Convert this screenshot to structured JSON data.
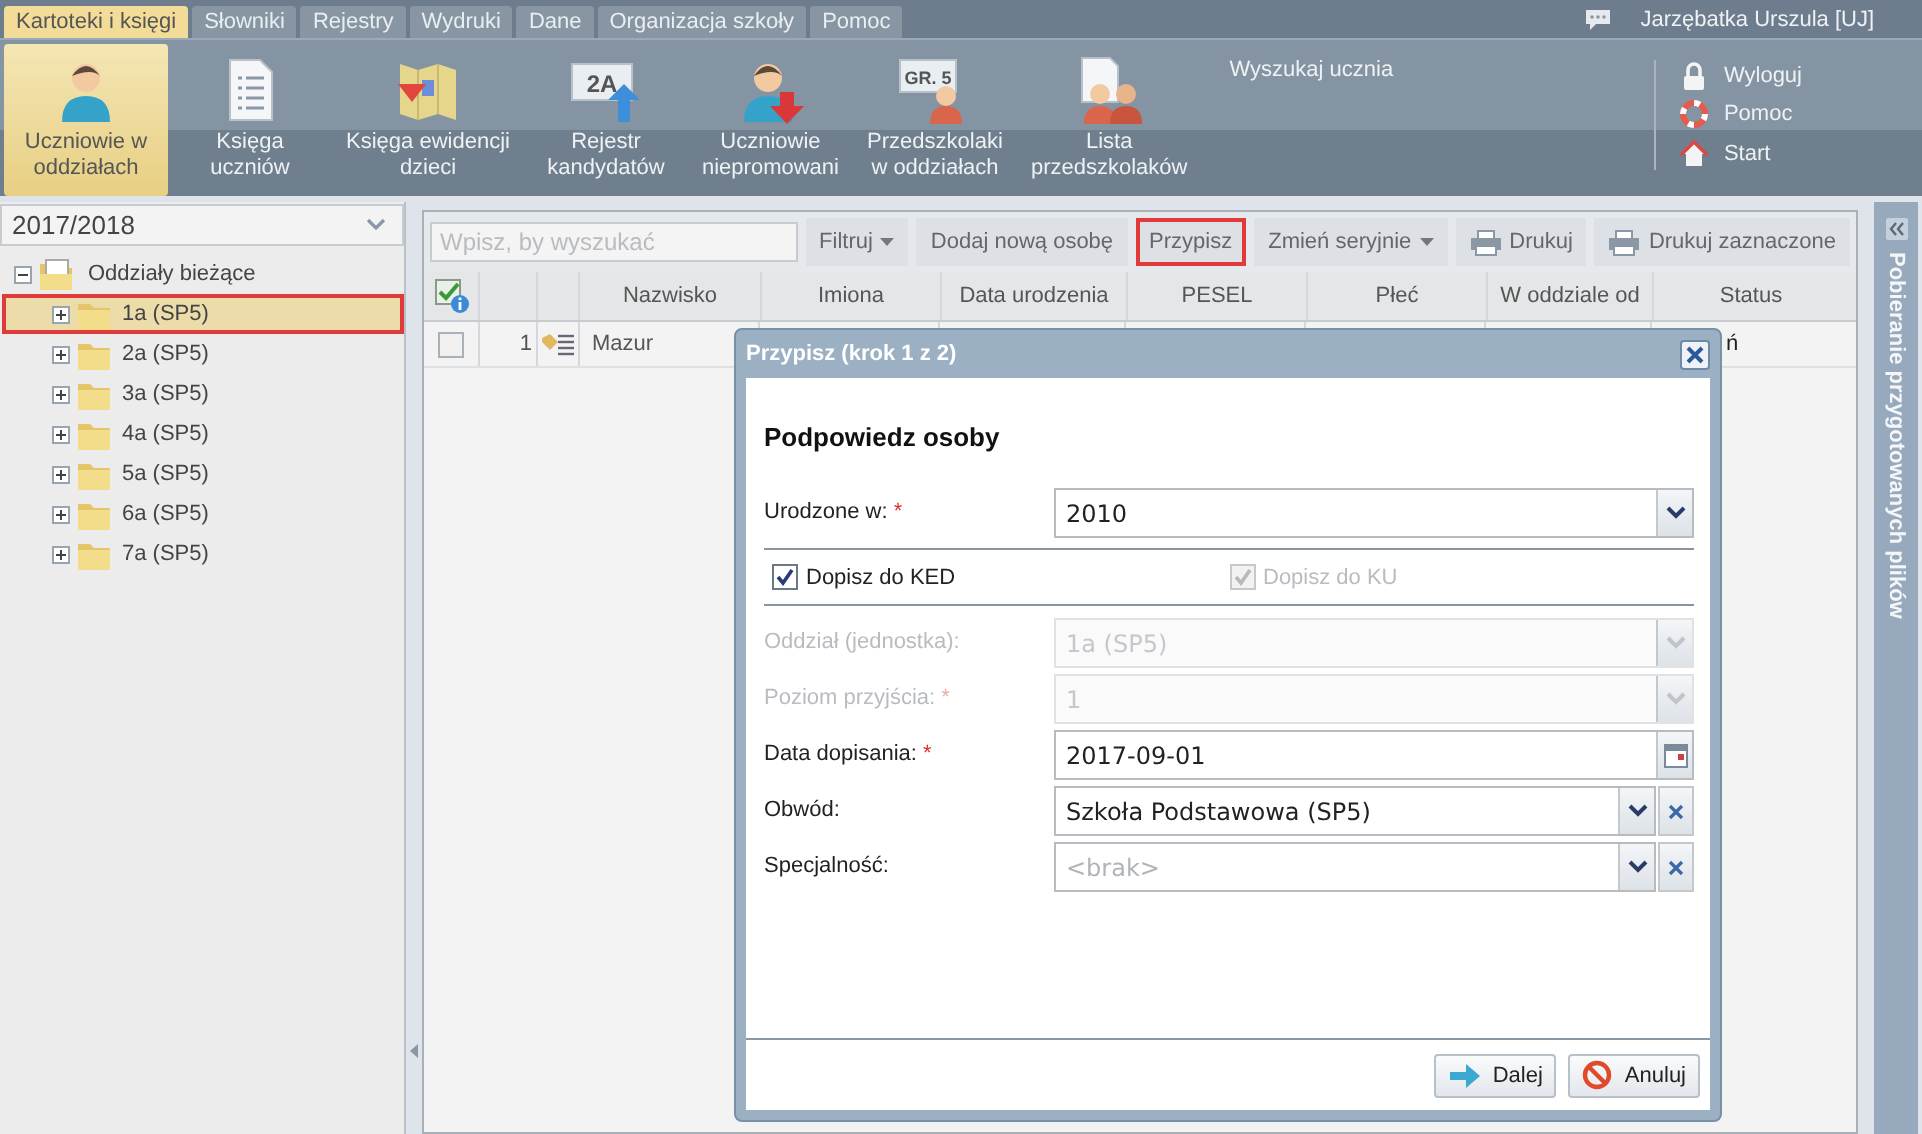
{
  "menu_tabs": [
    {
      "label": "Kartoteki i księgi",
      "selected": true
    },
    {
      "label": "Słowniki",
      "selected": false
    },
    {
      "label": "Rejestry",
      "selected": false
    },
    {
      "label": "Wydruki",
      "selected": false
    },
    {
      "label": "Dane",
      "selected": false
    },
    {
      "label": "Organizacja szkoły",
      "selected": false
    },
    {
      "label": "Pomoc",
      "selected": false
    }
  ],
  "user": {
    "name": "Jarzębatka Urszula [UJ]"
  },
  "ribbon": {
    "buttons": [
      {
        "label": "Uczniowie w oddziałach",
        "kind": "person",
        "selected": true
      },
      {
        "label": "Księga uczniów",
        "kind": "list",
        "selected": false
      },
      {
        "label": "Księga ewidencji dzieci",
        "kind": "map",
        "selected": false
      },
      {
        "label": "Rejestr kandydatów",
        "kind": "board",
        "badge": "2A",
        "selected": false
      },
      {
        "label": "Uczniowie niepromowani",
        "kind": "persondown",
        "selected": false
      },
      {
        "label": "Przedszkolaki w oddziałach",
        "kind": "boardperson",
        "badge": "GR. 5",
        "selected": false
      },
      {
        "label": "Lista przedszkolaków",
        "kind": "group",
        "selected": false
      }
    ],
    "search_label": "Wyszukaj ucznia",
    "links": [
      {
        "label": "Wyloguj",
        "kind": "lock"
      },
      {
        "label": "Pomoc",
        "kind": "lifebuoy"
      },
      {
        "label": "Start",
        "kind": "home"
      }
    ]
  },
  "sidebar": {
    "year": "2017/2018",
    "tree": {
      "label": "Oddziały bieżące",
      "expanded": true,
      "children": [
        {
          "label": "1a (SP5)",
          "expanded": false,
          "selected": true,
          "highlighted": true
        },
        {
          "label": "2a (SP5)",
          "expanded": false,
          "selected": false,
          "highlighted": false
        },
        {
          "label": "3a (SP5)",
          "expanded": false,
          "selected": false,
          "highlighted": false
        },
        {
          "label": "4a (SP5)",
          "expanded": false,
          "selected": false,
          "highlighted": false
        },
        {
          "label": "5a (SP5)",
          "expanded": false,
          "selected": false,
          "highlighted": false
        },
        {
          "label": "6a (SP5)",
          "expanded": false,
          "selected": false,
          "highlighted": false
        },
        {
          "label": "7a (SP5)",
          "expanded": false,
          "selected": false,
          "highlighted": false
        }
      ]
    }
  },
  "toolbar": {
    "search_placeholder": "Wpisz, by wyszukać",
    "buttons": [
      {
        "label": "Filtruj",
        "kind": "menu",
        "highlighted": false
      },
      {
        "label": "Dodaj nową osobę",
        "kind": "plain",
        "highlighted": false
      },
      {
        "label": "Przypisz",
        "kind": "plain",
        "highlighted": true
      },
      {
        "label": "Zmień seryjnie",
        "kind": "menu",
        "highlighted": false
      },
      {
        "label": "Drukuj",
        "kind": "print",
        "highlighted": false
      },
      {
        "label": "Drukuj zaznaczone",
        "kind": "print",
        "highlighted": false
      }
    ]
  },
  "table": {
    "columns": [
      "Nazwisko",
      "Imiona",
      "Data urodzenia",
      "PESEL",
      "Płeć",
      "W oddziale od",
      "Status"
    ],
    "rows": [
      {
        "checked": false,
        "number": "1",
        "surname": "Mazur",
        "status": "ń"
      }
    ]
  },
  "right_panel": {
    "title": "Pobieranie przygotowanych plików"
  },
  "dialog": {
    "title": "Przypisz (krok 1 z 2)",
    "heading": "Podpowiedz osoby",
    "fields": [
      {
        "kind": "select",
        "label": "Urodzone w:",
        "required_mark": "*",
        "value": "2010",
        "disabled": false
      },
      {
        "kind": "checks",
        "items": [
          {
            "label": "Dopisz do KED",
            "checked": true,
            "disabled": false
          },
          {
            "label": "Dopisz do KU",
            "checked": true,
            "disabled": true
          }
        ]
      },
      {
        "kind": "select",
        "label": "Oddział (jednostka):",
        "value": "1a (SP5)",
        "disabled": true
      },
      {
        "kind": "select",
        "label": "Poziom przyjścia:",
        "required_mark": "*",
        "value": "1",
        "disabled": true
      },
      {
        "kind": "date",
        "label": "Data dopisania:",
        "required_mark": "*",
        "value": "2017-09-01",
        "disabled": false
      },
      {
        "kind": "combo",
        "label": "Obwód:",
        "value": "Szkoła Podstawowa (SP5)",
        "disabled": false
      },
      {
        "kind": "combo",
        "label": "Specjalność:",
        "placeholder": "<brak>",
        "disabled": false
      }
    ],
    "buttons": [
      {
        "label": "Dalej",
        "kind": "next"
      },
      {
        "label": "Anuluj",
        "kind": "cancel"
      }
    ]
  }
}
